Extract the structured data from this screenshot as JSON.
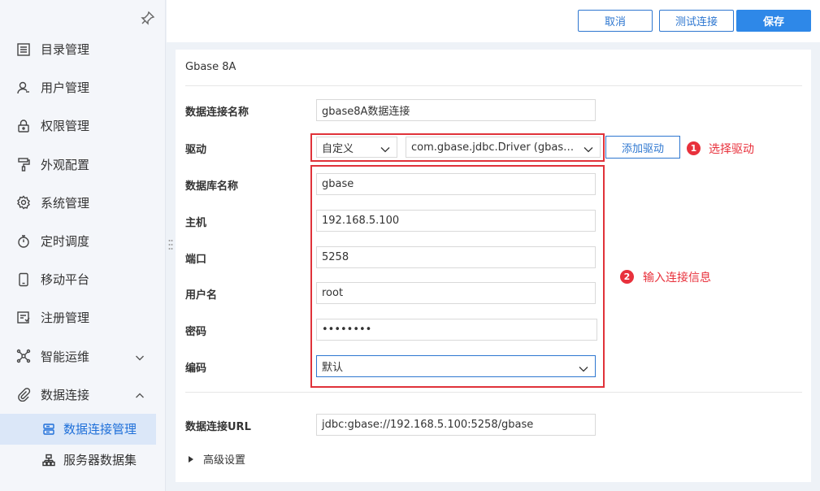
{
  "sidebar": {
    "items": [
      {
        "label": "目录管理",
        "icon": "list-icon"
      },
      {
        "label": "用户管理",
        "icon": "user-icon"
      },
      {
        "label": "权限管理",
        "icon": "lock-icon"
      },
      {
        "label": "外观配置",
        "icon": "paint-roller-icon"
      },
      {
        "label": "系统管理",
        "icon": "gear-icon"
      },
      {
        "label": "定时调度",
        "icon": "stopwatch-icon"
      },
      {
        "label": "移动平台",
        "icon": "mobile-icon"
      },
      {
        "label": "注册管理",
        "icon": "register-icon"
      },
      {
        "label": "智能运维",
        "icon": "network-icon",
        "expandable": true,
        "expanded": false
      },
      {
        "label": "数据连接",
        "icon": "link-icon",
        "expandable": true,
        "expanded": true
      }
    ],
    "sub_items": [
      {
        "label": "数据连接管理",
        "icon": "database-icon",
        "active": true
      },
      {
        "label": "服务器数据集",
        "icon": "server-icon",
        "active": false
      }
    ]
  },
  "toolbar": {
    "cancel_label": "取消",
    "test_label": "测试连接",
    "save_label": "保存"
  },
  "form": {
    "title": "Gbase 8A",
    "connection_name": {
      "label": "数据连接名称",
      "value": "gbase8A数据连接"
    },
    "driver": {
      "label": "驱动",
      "type_value": "自定义",
      "class_value": "com.gbase.jdbc.Driver (gbas…",
      "add_label": "添加驱动"
    },
    "database_name": {
      "label": "数据库名称",
      "value": "gbase"
    },
    "host": {
      "label": "主机",
      "value": "192.168.5.100"
    },
    "port": {
      "label": "端口",
      "value": "5258"
    },
    "username": {
      "label": "用户名",
      "value": "root"
    },
    "password": {
      "label": "密码",
      "value": "••••••••"
    },
    "encoding": {
      "label": "编码",
      "value": "默认"
    },
    "url": {
      "label": "数据连接URL",
      "value": "jdbc:gbase://192.168.5.100:5258/gbase"
    },
    "advanced_label": "高级设置"
  },
  "annotations": {
    "step1": {
      "number": "1",
      "text": "选择驱动"
    },
    "step2": {
      "number": "2",
      "text": "输入连接信息"
    }
  },
  "colors": {
    "accent": "#2e88e8",
    "annotation_red": "#e8313c",
    "active_bg": "#dbe7f8"
  }
}
